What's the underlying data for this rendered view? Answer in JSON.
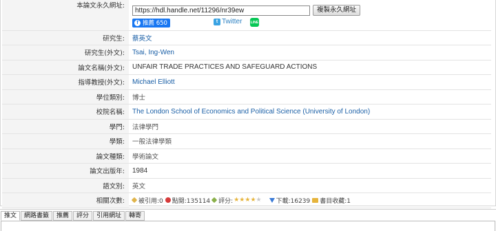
{
  "rows": {
    "url": {
      "label": "本論文永久網址:",
      "value": "https://hdl.handle.net/11296/nr39ew",
      "copy_label": "複製永久網址"
    },
    "social": {
      "fb_label": "推薦 650",
      "twitter_label": "Twitter"
    },
    "student": {
      "label": "研究生:",
      "value": "蔡英文"
    },
    "student_en": {
      "label": "研究生(外文):",
      "value": "Tsai, Ing-Wen"
    },
    "title_en": {
      "label": "論文名稱(外文):",
      "value": "UNFAIR TRADE PRACTICES AND SAFEGUARD ACTIONS"
    },
    "advisor_en": {
      "label": "指導教授(外文):",
      "value": "Michael Elliott"
    },
    "degree": {
      "label": "學位類別:",
      "value": "博士"
    },
    "school": {
      "label": "校院名稱:",
      "value": "The London School of Economics and Political Science (University of London)"
    },
    "discipline": {
      "label": "學門:",
      "value": "法律學門"
    },
    "category": {
      "label": "學類:",
      "value": "一般法律學類"
    },
    "type": {
      "label": "論文種類:",
      "value": "學術論文"
    },
    "year": {
      "label": "論文出版年:",
      "value": "1984"
    },
    "language": {
      "label": "語文別:",
      "value": "英文"
    },
    "stats": {
      "label": "相關次數:",
      "cited": "被引用:0",
      "views": "點閱:135114",
      "rating": "評分:",
      "rating_value": 4,
      "rating_max": 5,
      "downloads": "下載:16239",
      "bookmarks": "書目收藏:1"
    }
  },
  "tabs": [
    "推文",
    "網路書籤",
    "推薦",
    "評分",
    "引用網址",
    "轉寄"
  ],
  "colors": {
    "label_bg": "#f4f4f4",
    "link": "#1a5fa6",
    "facebook": "#1877f2",
    "line": "#06c755"
  }
}
